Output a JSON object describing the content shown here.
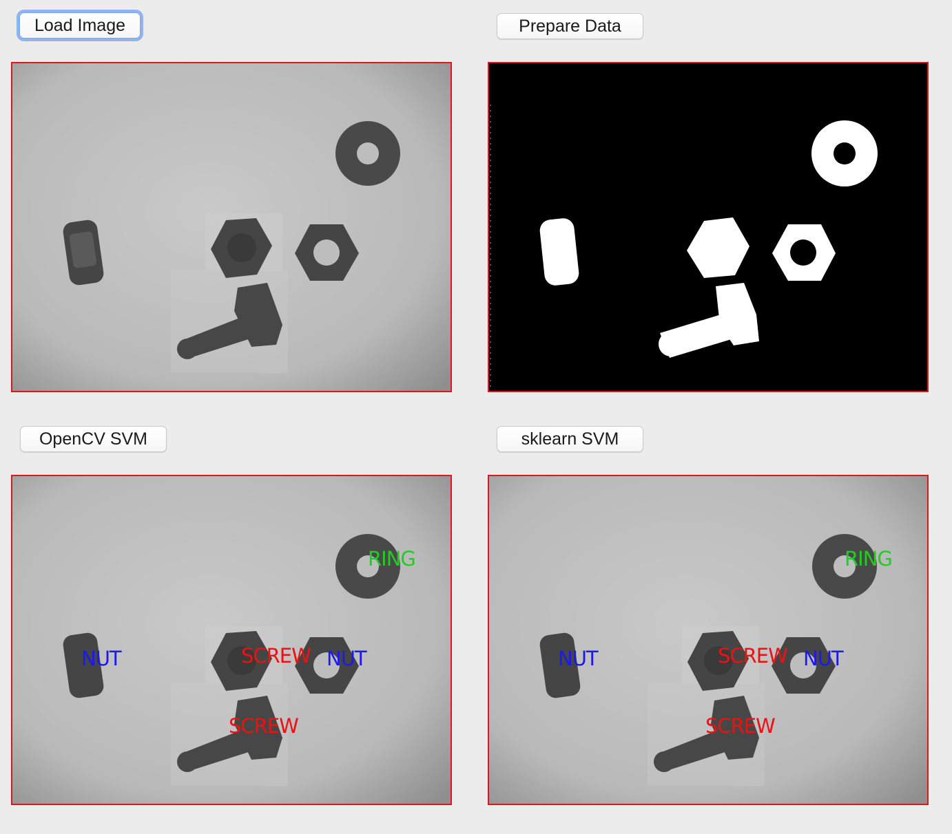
{
  "buttons": {
    "load_image": "Load Image",
    "prepare_data": "Prepare Data",
    "opencv_svm": "OpenCV SVM",
    "sklearn_svm": "sklearn SVM"
  },
  "labels": {
    "ring": "RING",
    "nut": "NUT",
    "screw": "SCREW"
  },
  "colors": {
    "panel_border": "#e0141c",
    "ring_label": "#22cc22",
    "nut_label": "#1a1aee",
    "screw_label": "#ee1111"
  }
}
